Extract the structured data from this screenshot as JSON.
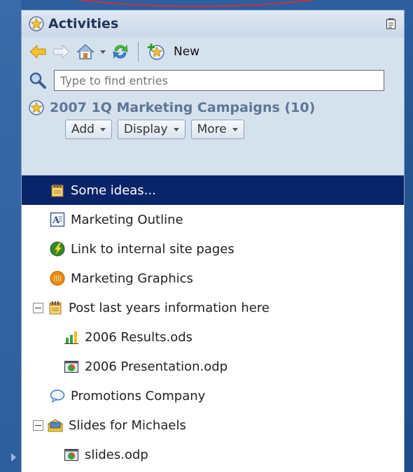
{
  "panel": {
    "title": "Activities"
  },
  "toolbar": {
    "new_label": "New"
  },
  "search": {
    "placeholder": "Type to find entries"
  },
  "activity": {
    "title": "2007 1Q Marketing Campaigns (10)",
    "buttons": [
      "Add",
      "Display",
      "More"
    ]
  },
  "entries": [
    {
      "label": "Some ideas...",
      "icon": "notebook-icon",
      "selected": true
    },
    {
      "label": "Marketing Outline",
      "icon": "text-document-icon"
    },
    {
      "label": "Link to internal site pages",
      "icon": "link-globe-icon"
    },
    {
      "label": "Marketing Graphics",
      "icon": "graphics-icon"
    },
    {
      "label": "Post last years information here",
      "icon": "notebook-icon",
      "expanded": true
    },
    {
      "label": "2006 Results.ods",
      "icon": "spreadsheet-icon"
    },
    {
      "label": "2006 Presentation.odp",
      "icon": "presentation-icon"
    },
    {
      "label": "Promotions Company",
      "icon": "chat-bubble-icon"
    },
    {
      "label": "Slides for Michaels",
      "icon": "mail-folder-icon",
      "expanded": true
    },
    {
      "label": "slides.odp",
      "icon": "presentation-icon"
    }
  ],
  "colors": {
    "selected_row": "#0a2469",
    "panel_bg": "#d6e1ee",
    "desktop_bg": "#24548f"
  }
}
